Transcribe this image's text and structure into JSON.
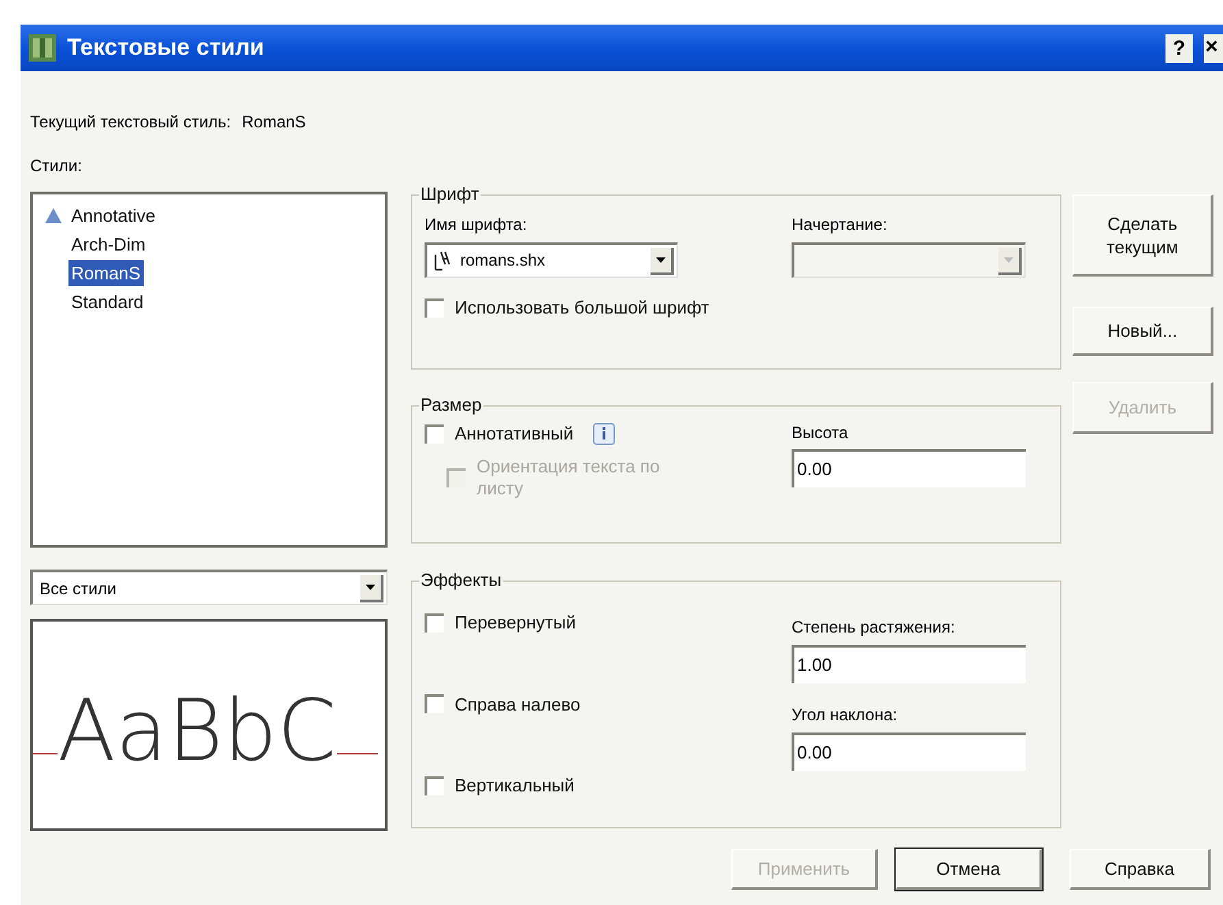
{
  "window": {
    "title": "Текстовые стили",
    "help_button": "?",
    "close_button": "×"
  },
  "current_style": {
    "label": "Текущий текстовый стиль:",
    "value": "RomanS"
  },
  "styles": {
    "label": "Стили:",
    "items": [
      {
        "label": "Annotative",
        "annotative": true,
        "selected": false
      },
      {
        "label": "Arch-Dim",
        "annotative": false,
        "selected": false
      },
      {
        "label": "RomanS",
        "annotative": false,
        "selected": true
      },
      {
        "label": "Standard",
        "annotative": false,
        "selected": false
      }
    ]
  },
  "filter": {
    "value": "Все стили"
  },
  "preview": {
    "text": "AaBbC"
  },
  "font": {
    "title": "Шрифт",
    "font_name": {
      "label": "Имя шрифта:",
      "value": "romans.shx"
    },
    "font_style": {
      "label": "Начертание:",
      "disabled": true
    },
    "big_font": {
      "label": "Использовать большой шрифт",
      "checked": false
    }
  },
  "size": {
    "title": "Размер",
    "annotative": {
      "label": "Аннотативный",
      "checked": false
    },
    "orientation": {
      "label": "Ориентация текста по листу",
      "checked": false,
      "disabled": true
    },
    "height": {
      "label": "Высота",
      "value": "0.00"
    }
  },
  "effects": {
    "title": "Эффекты",
    "checkboxes": [
      {
        "label": "Перевернутый",
        "checked": false
      },
      {
        "label": "Справа налево",
        "checked": false
      },
      {
        "label": "Вертикальный",
        "checked": false
      }
    ],
    "width_factor": {
      "label": "Степень растяжения:",
      "value": "1.00"
    },
    "oblique": {
      "label": "Угол наклона:",
      "value": "0.00"
    }
  },
  "side_buttons": [
    {
      "label": "Сделать текущим",
      "disabled": false
    },
    {
      "label": "Новый...",
      "disabled": false
    },
    {
      "label": "Удалить",
      "disabled": true
    }
  ],
  "footer_buttons": [
    {
      "label": "Применить",
      "disabled": true,
      "default": false
    },
    {
      "label": "Отмена",
      "disabled": false,
      "default": true
    },
    {
      "label": "Справка",
      "disabled": false,
      "default": false
    }
  ]
}
